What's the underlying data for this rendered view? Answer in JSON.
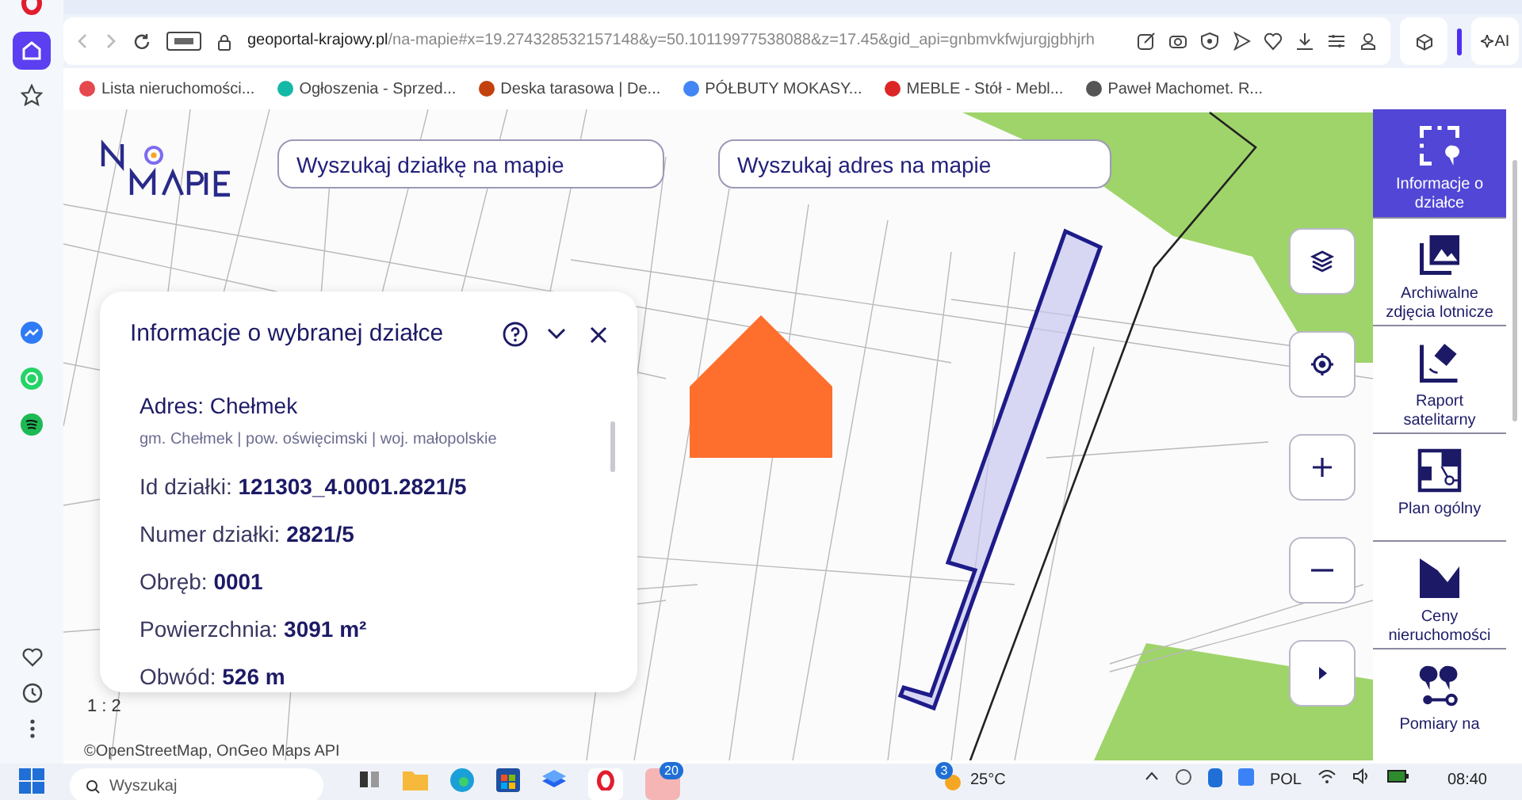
{
  "browser": {
    "url_domain": "geoportal-krajowy.pl",
    "url_path": "/na-mapie#x=19.274328532157148&y=50.10119977538088&z=17.45&gid_api=gnbmvkfwjurgjgbhjrh",
    "ai_label": "AI",
    "bookmarks": [
      {
        "label": "Lista nieruchomości...",
        "color": "#e5484d"
      },
      {
        "label": "Ogłoszenia - Sprzed...",
        "color": "#14b8a6"
      },
      {
        "label": "Deska tarasowa | De...",
        "color": "#c2410c"
      },
      {
        "label": "PÓŁBUTY MOKASY...",
        "color": "#4285f4"
      },
      {
        "label": "MEBLE - Stół - Mebl...",
        "color": "#dc2626"
      },
      {
        "label": "Paweł Machomet. R...",
        "color": "#555555"
      }
    ]
  },
  "map": {
    "search_fields": [
      {
        "placeholder": "Wyszukaj działkę na mapie"
      },
      {
        "placeholder": "Wyszukaj adres na mapie"
      }
    ],
    "scale": "1 : 2",
    "attribution": "©OpenStreetMap, OnGeo Maps API"
  },
  "info_panel": {
    "title": "Informacje o wybranej działce",
    "address": "Adres: Chełmek",
    "address_detail": "gm. Chełmek | pow. oświęcimski | woj. małopolskie",
    "fields": [
      {
        "label": "Id działki:",
        "value": "121303_4.0001.2821/5"
      },
      {
        "label": "Numer działki:",
        "value": "2821/5"
      },
      {
        "label": "Obręb:",
        "value": "0001"
      },
      {
        "label": "Powierzchnia:",
        "value": "3091 m²"
      },
      {
        "label": "Obwód:",
        "value": "526 m"
      }
    ]
  },
  "tools": [
    {
      "kind": "info",
      "label": "Informacje o działce",
      "selected": true
    },
    {
      "kind": "photo",
      "label": "Archiwalne zdjęcia lotnicze",
      "selected": false
    },
    {
      "kind": "satellite",
      "label": "Raport satelitarny",
      "selected": false
    },
    {
      "kind": "plan",
      "label": "Plan ogólny",
      "selected": false
    },
    {
      "kind": "prices",
      "label": "Ceny nieruchomości",
      "selected": false
    },
    {
      "kind": "measure",
      "label": "Pomiary na",
      "selected": false
    }
  ],
  "taskbar": {
    "search_placeholder": "Wyszukaj",
    "mail_badge": "20",
    "weather_badge": "3",
    "temperature": "25°C",
    "language": "POL",
    "time": "08:40"
  }
}
